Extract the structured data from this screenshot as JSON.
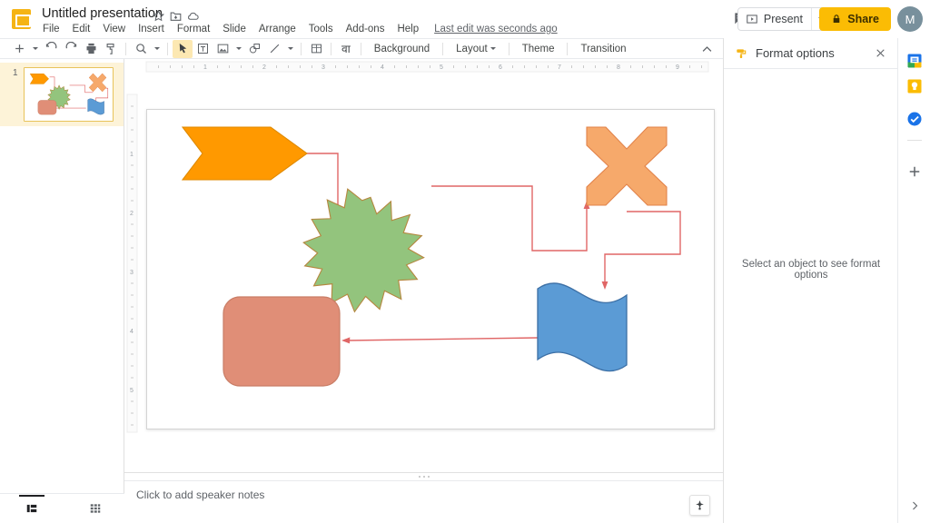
{
  "app": {
    "doc_title": "Untitled presentation",
    "doc_icon": "slides-icon",
    "last_edit": "Last edit was seconds ago"
  },
  "title_actions": [
    {
      "name": "star-icon",
      "label": "Star"
    },
    {
      "name": "move-to-folder-icon",
      "label": "Move"
    },
    {
      "name": "cloud-status-icon",
      "label": "Saved to Drive"
    }
  ],
  "menubar": {
    "items": [
      {
        "label": "File"
      },
      {
        "label": "Edit"
      },
      {
        "label": "View"
      },
      {
        "label": "Insert"
      },
      {
        "label": "Format"
      },
      {
        "label": "Slide"
      },
      {
        "label": "Arrange"
      },
      {
        "label": "Tools"
      },
      {
        "label": "Add-ons"
      },
      {
        "label": "Help"
      }
    ]
  },
  "header_actions": {
    "comment_icon": "comment-icon",
    "present_label": "Present",
    "present_icon": "present-icon",
    "share_label": "Share",
    "share_icon": "lock-icon",
    "avatar_initial": "M"
  },
  "toolbar": {
    "buttons": [
      {
        "name": "new-slide-button",
        "icon": "plus-icon",
        "selected": false
      },
      {
        "name": "undo-button",
        "icon": "undo-icon",
        "selected": false
      },
      {
        "name": "redo-button",
        "icon": "redo-icon",
        "selected": false
      },
      {
        "name": "print-button",
        "icon": "print-icon",
        "selected": false
      },
      {
        "name": "paint-format-button",
        "icon": "paint-format-icon",
        "selected": false
      },
      {
        "name": "zoom-button",
        "icon": "magnifier-icon",
        "selected": false
      },
      {
        "name": "select-tool-button",
        "icon": "cursor-icon",
        "selected": true
      },
      {
        "name": "text-box-button",
        "icon": "text-box-icon",
        "selected": false
      },
      {
        "name": "insert-image-button",
        "icon": "image-icon",
        "selected": false
      },
      {
        "name": "shape-button",
        "icon": "shape-icon",
        "selected": false
      },
      {
        "name": "line-button",
        "icon": "line-icon",
        "selected": false
      },
      {
        "name": "insert-table-button",
        "icon": "table-icon",
        "selected": false
      }
    ],
    "input_tools_glyph": "वा",
    "background_label": "Background",
    "layout_label": "Layout",
    "theme_label": "Theme",
    "transition_label": "Transition",
    "collapse_icon": "chevron-up-icon"
  },
  "filmstrip": {
    "slides": [
      {
        "number": "1",
        "selected": true
      }
    ],
    "view_buttons": [
      {
        "name": "filmstrip-view-button",
        "icon": "filmstrip-icon",
        "selected": true
      },
      {
        "name": "grid-view-button",
        "icon": "grid-icon",
        "selected": false
      }
    ]
  },
  "rulers": {
    "horizontal_labels": [
      "1",
      "2",
      "3",
      "4",
      "5",
      "6",
      "7",
      "8",
      "9"
    ],
    "vertical_labels": [
      "1",
      "2",
      "3",
      "4",
      "5"
    ]
  },
  "slide": {
    "shapes": [
      {
        "name": "orange-arrow-shape",
        "kind": "chevron-arrow",
        "fill": "#FF9900",
        "stroke": "#E08A00"
      },
      {
        "name": "green-star-shape",
        "kind": "16-point-star",
        "fill": "#93C47D",
        "stroke": "#B5873F"
      },
      {
        "name": "orange-cross-shape",
        "kind": "cross-x",
        "fill": "#F6A96B",
        "stroke": "#E2834A"
      },
      {
        "name": "blue-wave-shape",
        "kind": "wave-flag",
        "fill": "#5B9BD5",
        "stroke": "#3C6FA5"
      },
      {
        "name": "salmon-rounded-rect-shape",
        "kind": "rounded-rectangle",
        "fill": "#E08E77",
        "stroke": "#C97D66"
      }
    ],
    "connectors": [
      {
        "name": "connector-arrow-to-star",
        "color": "#E06666"
      },
      {
        "name": "connector-star-to-cross",
        "color": "#E06666"
      },
      {
        "name": "connector-cross-to-wave",
        "color": "#E06666"
      },
      {
        "name": "connector-wave-to-rect",
        "color": "#E06666"
      }
    ]
  },
  "notes": {
    "placeholder": "Click to add speaker notes",
    "explore_icon": "explore-icon"
  },
  "format_panel": {
    "title": "Format options",
    "icon": "paint-roller-icon",
    "close_icon": "close-icon",
    "empty_message": "Select an object to see format options"
  },
  "side_rail": {
    "items": [
      {
        "name": "calendar-icon",
        "label": "Calendar"
      },
      {
        "name": "keep-icon",
        "label": "Keep"
      },
      {
        "name": "tasks-icon",
        "label": "Tasks"
      },
      {
        "name": "add-addon-icon",
        "label": "Get add-ons"
      }
    ],
    "expand_icon": "chevron-right-icon"
  },
  "colors": {
    "share_yellow": "#FBBC04",
    "connector_red": "#E06666",
    "thumb_selected": "#FDF3D8"
  }
}
